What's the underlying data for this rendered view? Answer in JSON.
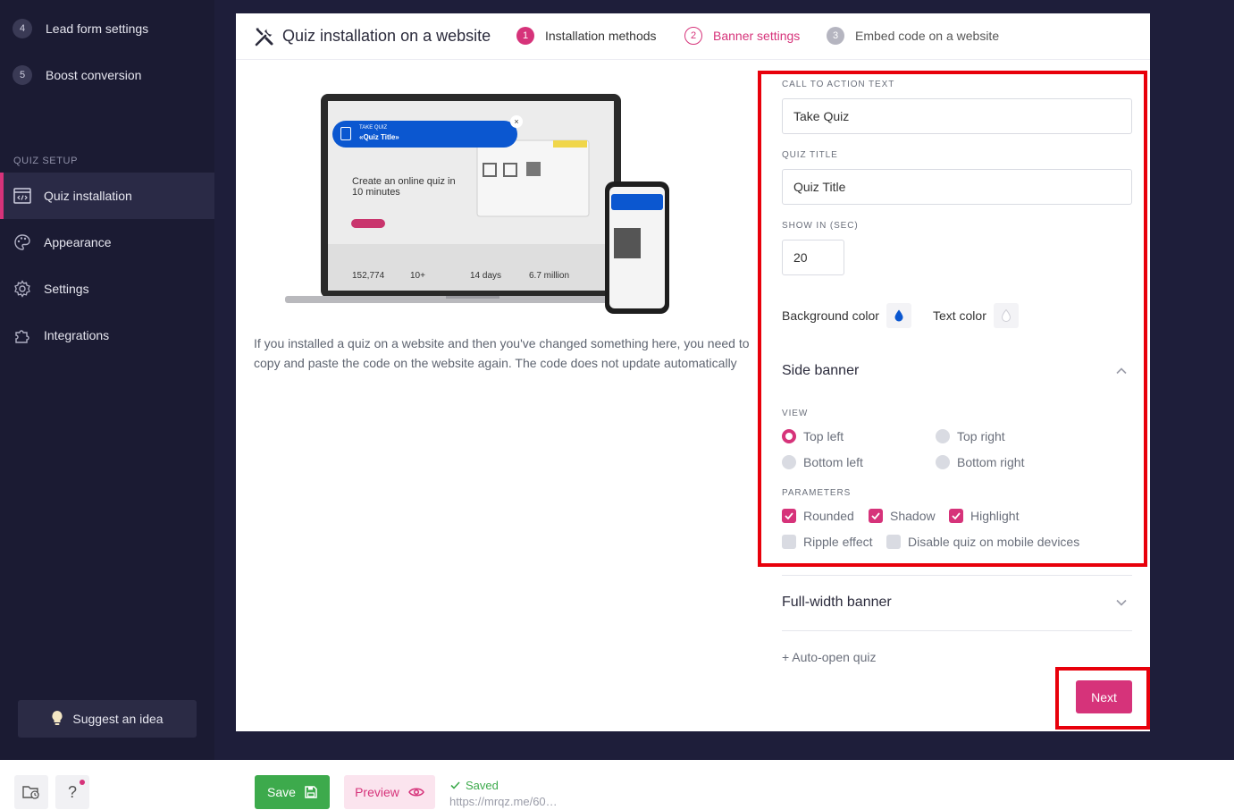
{
  "sidebar": {
    "steps": [
      {
        "num": "4",
        "label": "Lead form settings"
      },
      {
        "num": "5",
        "label": "Boost conversion"
      }
    ],
    "section_label": "QUIZ SETUP",
    "items": [
      {
        "label": "Quiz installation",
        "icon": "code-window-icon",
        "active": true
      },
      {
        "label": "Appearance",
        "icon": "palette-icon",
        "active": false
      },
      {
        "label": "Settings",
        "icon": "gear-icon",
        "active": false
      },
      {
        "label": "Integrations",
        "icon": "puzzle-icon",
        "active": false
      }
    ],
    "suggest_label": "Suggest an idea"
  },
  "header": {
    "title": "Quiz installation on a website",
    "steps": [
      {
        "num": "1",
        "label": "Installation methods",
        "state": "done"
      },
      {
        "num": "2",
        "label": "Banner settings",
        "state": "current"
      },
      {
        "num": "3",
        "label": "Embed code on a website",
        "state": "pending"
      }
    ]
  },
  "preview": {
    "banner_small": "TAKE QUIZ",
    "banner_title": "«Quiz Title»",
    "hero_text": "Create an online quiz in 10 minutes",
    "stats": [
      "152,774",
      "10+",
      "14 days",
      "6.7 million"
    ],
    "note": "If you installed a quiz on a website and then you've changed something here, you need to copy and paste the code on the website again. The code does not update automatically"
  },
  "form": {
    "cta_label": "CALL TO ACTION TEXT",
    "cta_value": "Take Quiz",
    "title_label": "QUIZ TITLE",
    "title_value": "Quiz Title",
    "show_label": "SHOW IN (SEC)",
    "show_value": "20",
    "bg_color_label": "Background color",
    "text_color_label": "Text color",
    "bg_color": "#0b57d0",
    "text_color": "#ffffff",
    "side_banner_title": "Side banner",
    "view_label": "VIEW",
    "view_options": [
      {
        "label": "Top left",
        "selected": true
      },
      {
        "label": "Top right",
        "selected": false
      },
      {
        "label": "Bottom left",
        "selected": false
      },
      {
        "label": "Bottom right",
        "selected": false
      }
    ],
    "params_label": "PARAMETERS",
    "params": [
      {
        "label": "Rounded",
        "checked": true
      },
      {
        "label": "Shadow",
        "checked": true
      },
      {
        "label": "Highlight",
        "checked": true
      },
      {
        "label": "Ripple effect",
        "checked": false
      },
      {
        "label": "Disable quiz on mobile devices",
        "checked": false
      }
    ],
    "full_width_title": "Full-width banner",
    "auto_open": "+ Auto-open quiz"
  },
  "next_label": "Next",
  "bottombar": {
    "help": "?",
    "save_label": "Save",
    "preview_label": "Preview",
    "saved_text": "Saved",
    "url": "https://mrqz.me/60…"
  },
  "colors": {
    "accent": "#d6337a",
    "sidebar_bg": "#1b1b33",
    "save_green": "#3daa4c",
    "highlight_red": "#e8000b"
  }
}
